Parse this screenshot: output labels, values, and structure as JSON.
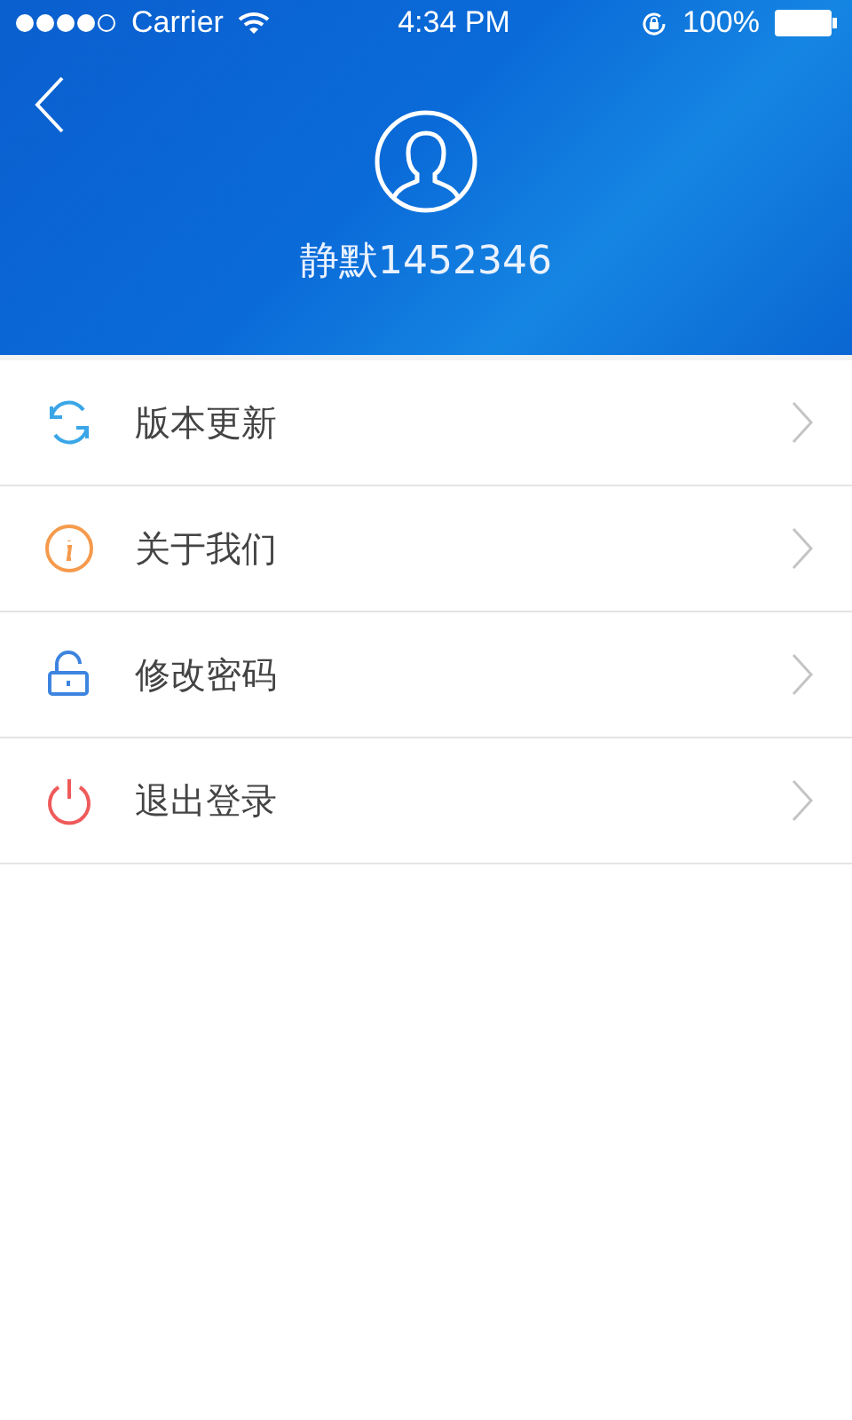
{
  "status_bar": {
    "carrier": "Carrier",
    "time": "4:34 PM",
    "battery": "100%"
  },
  "header": {
    "username": "静默1452346"
  },
  "menu": [
    {
      "kind": "update",
      "label": "版本更新",
      "color": "#3aa6e8"
    },
    {
      "kind": "about",
      "label": "关于我们",
      "color": "#f59a4c"
    },
    {
      "kind": "password",
      "label": "修改密码",
      "color": "#3d84e0"
    },
    {
      "kind": "logout",
      "label": "退出登录",
      "color": "#ef5a5a"
    }
  ]
}
